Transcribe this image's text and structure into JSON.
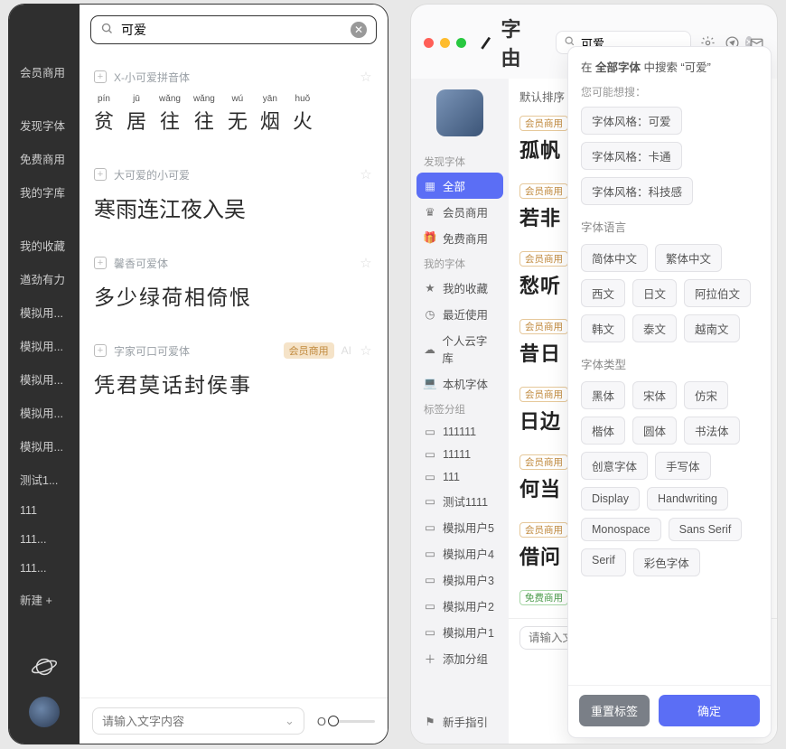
{
  "left": {
    "search": {
      "value": "可爱"
    },
    "sidebar": {
      "items": [
        "会员商用",
        "发现字体",
        "免费商用",
        "我的字库",
        "我的收藏",
        "遒劲有力",
        "模拟用...",
        "模拟用...",
        "模拟用...",
        "模拟用...",
        "模拟用...",
        "测试1...",
        "111",
        "111...",
        "111...",
        "新建 +"
      ]
    },
    "fonts": [
      {
        "name": "X-小可爱拼音体",
        "badge": null,
        "preview_type": "pinyin",
        "pinyin": [
          {
            "py": "pín",
            "ch": "贫"
          },
          {
            "py": "jū",
            "ch": "居"
          },
          {
            "py": "wǎng",
            "ch": "往"
          },
          {
            "py": "wǎng",
            "ch": "往"
          },
          {
            "py": "wú",
            "ch": "无"
          },
          {
            "py": "yān",
            "ch": "烟"
          },
          {
            "py": "huǒ",
            "ch": "火"
          }
        ]
      },
      {
        "name": "大可爱的小可爱",
        "badge": null,
        "preview_type": "handwrite",
        "preview": "寒雨连江夜入吴"
      },
      {
        "name": "馨香可爱体",
        "badge": null,
        "preview_type": "brush",
        "preview": "多少绿荷相倚恨"
      },
      {
        "name": "字家可口可爱体",
        "badge": "会员商用",
        "preview_type": "slab",
        "preview": "凭君莫话封侯事",
        "has_ai": true
      }
    ],
    "footer": {
      "placeholder": "请输入文字内容"
    }
  },
  "right": {
    "logo": "字由",
    "search": {
      "value": "可爱"
    },
    "sidebar": {
      "groups": [
        {
          "title": "发现字体",
          "items": [
            {
              "icon": "grid",
              "label": "全部",
              "active": true
            },
            {
              "icon": "crown",
              "label": "会员商用"
            },
            {
              "icon": "gift",
              "label": "免费商用"
            }
          ]
        },
        {
          "title": "我的字体",
          "items": [
            {
              "icon": "star",
              "label": "我的收藏"
            },
            {
              "icon": "clock",
              "label": "最近使用"
            },
            {
              "icon": "cloud",
              "label": "个人云字库"
            },
            {
              "icon": "laptop",
              "label": "本机字体"
            }
          ]
        },
        {
          "title": "标签分组",
          "items": [
            {
              "icon": "folder",
              "label": "111111"
            },
            {
              "icon": "folder",
              "label": "11111"
            },
            {
              "icon": "folder",
              "label": "111"
            },
            {
              "icon": "folder",
              "label": "测试1111"
            },
            {
              "icon": "folder",
              "label": "模拟用户5"
            },
            {
              "icon": "folder",
              "label": "模拟用户4"
            },
            {
              "icon": "folder",
              "label": "模拟用户3"
            },
            {
              "icon": "folder",
              "label": "模拟用户2"
            },
            {
              "icon": "folder",
              "label": "模拟用户1"
            },
            {
              "icon": "plus",
              "label": "添加分组"
            }
          ]
        }
      ],
      "guide": "新手指引"
    },
    "sort": {
      "label": "默认排序"
    },
    "fontlist": [
      {
        "badge": "会员商用",
        "preview": "孤帆"
      },
      {
        "badge": "会员商用",
        "preview": "若非"
      },
      {
        "badge": "会员商用",
        "preview": "愁听"
      },
      {
        "badge": "会员商用",
        "preview": "昔日"
      },
      {
        "badge": "会员商用",
        "preview": "日边"
      },
      {
        "badge": "会员商用",
        "preview": "何当"
      },
      {
        "badge": "会员商用",
        "preview": "借问"
      },
      {
        "badge_green": "免费商用",
        "preview": ""
      }
    ],
    "footer": {
      "placeholder": "请输入文"
    }
  },
  "filter": {
    "hint_prefix": "在 ",
    "hint_scope": "全部字体",
    "hint_mid": " 中搜索 “",
    "hint_term": "可爱",
    "hint_suffix": "”",
    "suggest_label": "您可能想搜：",
    "suggest": [
      "字体风格：可爱",
      "字体风格：卡通",
      "字体风格：科技感"
    ],
    "lang_title": "字体语言",
    "langs": [
      "简体中文",
      "繁体中文",
      "西文",
      "日文",
      "阿拉伯文",
      "韩文",
      "泰文",
      "越南文"
    ],
    "type_title": "字体类型",
    "types": [
      "黑体",
      "宋体",
      "仿宋",
      "楷体",
      "圆体",
      "书法体",
      "创意字体",
      "手写体",
      "Display",
      "Handwriting",
      "Monospace",
      "Sans Serif",
      "Serif",
      "彩色字体"
    ],
    "reset": "重置标签",
    "ok": "确定"
  }
}
